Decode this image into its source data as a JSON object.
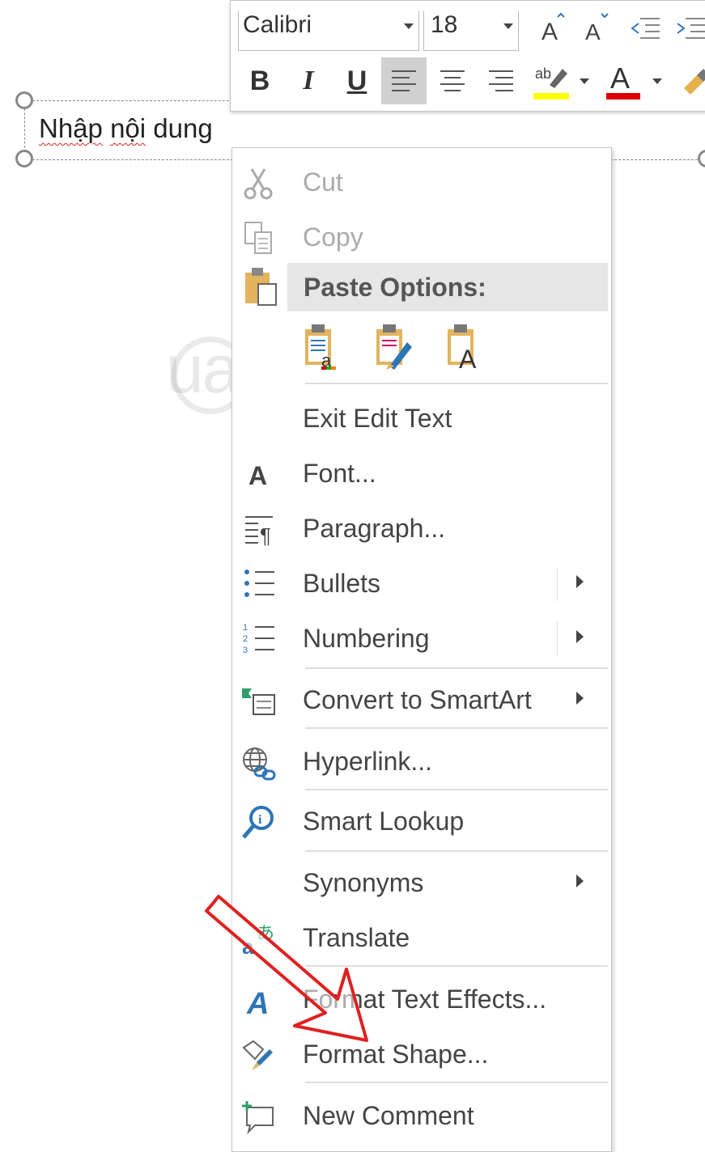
{
  "textbox": {
    "text_part1": "Nhập",
    "text_space1": " ",
    "text_part2": "nội",
    "text_rest": " dung"
  },
  "mini_toolbar": {
    "font_name": "Calibri",
    "font_size": "18",
    "grow_font_icon": "grow-font-icon",
    "shrink_font_icon": "shrink-font-icon",
    "bold_label": "B",
    "italic_label": "I",
    "underline_label": "U",
    "highlight_color": "#ffff00",
    "font_color": "#e00000"
  },
  "menu": {
    "cut": "Cut",
    "copy": "Copy",
    "paste_options": "Paste Options:",
    "exit_edit_text": "Exit Edit Text",
    "font": "Font...",
    "paragraph": "Paragraph...",
    "bullets": "Bullets",
    "numbering": "Numbering",
    "convert_smartart": "Convert to SmartArt",
    "hyperlink": "Hyperlink...",
    "smart_lookup": "Smart Lookup",
    "synonyms": "Synonyms",
    "translate": "Translate",
    "format_text_effects": "Format Text Effects...",
    "format_shape": "Format Shape...",
    "new_comment": "New Comment"
  },
  "watermark": "uantrimang",
  "colors": {
    "accent_blue": "#2e75b6",
    "arrow_red": "#e02020"
  }
}
